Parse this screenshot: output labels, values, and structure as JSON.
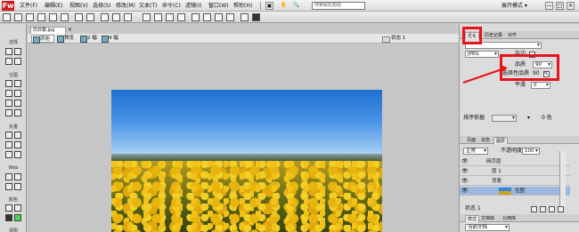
{
  "menubar": {
    "items": [
      "文件(F)",
      "编辑(E)",
      "视图(V)",
      "选择(S)",
      "修改(M)",
      "文本(T)",
      "命令(C)",
      "滤镜(I)",
      "窗口(W)",
      "帮助(H)"
    ],
    "search_placeholder": "搜索联机帮助",
    "workspace_label": "展开模式 ▾",
    "window_buttons": [
      "—",
      "□",
      "✕"
    ]
  },
  "tools": {
    "sections": [
      "选择",
      "位图",
      "矢量",
      "Web",
      "颜色",
      "视图"
    ]
  },
  "document": {
    "tab_title": "向日葵.jpg",
    "tab_close": "×",
    "views": [
      "原始",
      "预览",
      "2 幅",
      "4 幅"
    ],
    "state_label": "状态 1"
  },
  "right_panel": {
    "tabs": [
      "优化",
      "历史记录",
      "对齐"
    ],
    "format": "JPEG",
    "matte_label": "杂边",
    "quality_label": "品质",
    "quality_value": "90",
    "selective_quality_label": "选择性品质",
    "selective_quality_value": "90",
    "smoothing_label": "平滑",
    "smoothing_value": "0",
    "sort_label": "排序依据",
    "colors_count": "0 色",
    "layers_tabs": [
      "页面",
      "状态",
      "图层"
    ],
    "blend_mode": "正常",
    "opacity_label": "不透明度",
    "opacity_value": "100",
    "layers": [
      {
        "name": "网页层",
        "indent": 1
      },
      {
        "name": "层 1",
        "indent": 1
      },
      {
        "name": "背景",
        "indent": 1
      },
      {
        "name": "位图",
        "indent": 2,
        "selected": true
      }
    ],
    "bottom_state": "状态 1",
    "bottom_tabs": [
      "样式",
      "文档库",
      "公用库"
    ],
    "current_doc": "当前文档"
  },
  "colors": {
    "highlight_red": "#e8141c",
    "selection_blue": "#9cb8e0"
  }
}
